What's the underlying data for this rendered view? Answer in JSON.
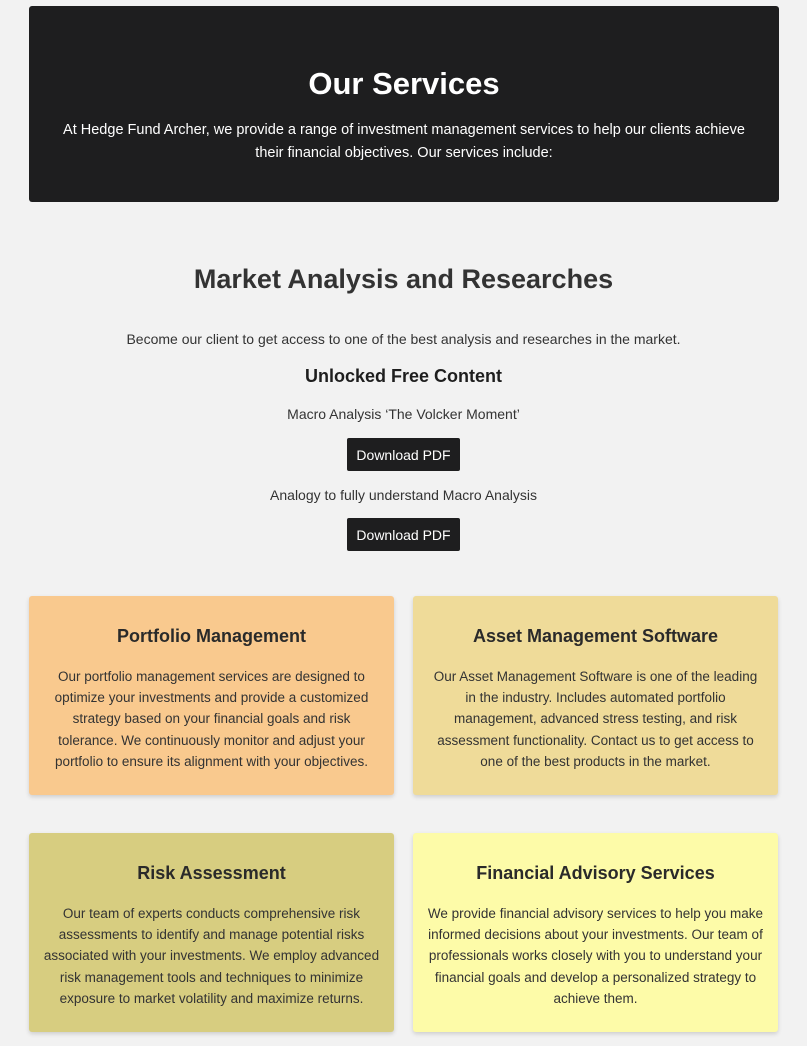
{
  "hero": {
    "title": "Our Services",
    "description": "At Hedge Fund Archer, we provide a range of investment management services to help our clients achieve their financial objectives. Our services include:"
  },
  "market": {
    "title": "Market Analysis and Researches",
    "intro": "Become our client to get access to one of the best analysis and researches in the market.",
    "subhead": "Unlocked Free Content",
    "documents": [
      {
        "label": "Macro Analysis ‘The Volcker Moment’",
        "button": "Download PDF"
      },
      {
        "label": "Analogy to fully understand Macro Analysis",
        "button": "Download PDF"
      }
    ]
  },
  "services": [
    {
      "title": "Portfolio Management",
      "text": "Our portfolio management services are designed to optimize your investments and provide a customized strategy based on your financial goals and risk tolerance. We continuously monitor and adjust your portfolio to ensure its alignment with your objectives.",
      "color": "#f9c98e"
    },
    {
      "title": "Asset Management Software",
      "text": "Our Asset Management Software is one of the leading in the industry. Includes automated portfolio management, advanced stress testing, and risk assessment functionality. Contact us to get access to one of the best products in the market.",
      "color": "#efdb99"
    },
    {
      "title": "Risk Assessment",
      "text": "Our team of experts conducts comprehensive risk assessments to identify and manage potential risks associated with your investments. We employ advanced risk management tools and techniques to minimize exposure to market volatility and maximize returns.",
      "color": "#d7cd80"
    },
    {
      "title": "Financial Advisory Services",
      "text": "We provide financial advisory services to help you make informed decisions about your investments. Our team of professionals works closely with you to understand your financial goals and develop a personalized strategy to achieve them.",
      "color": "#fdfba8"
    }
  ]
}
